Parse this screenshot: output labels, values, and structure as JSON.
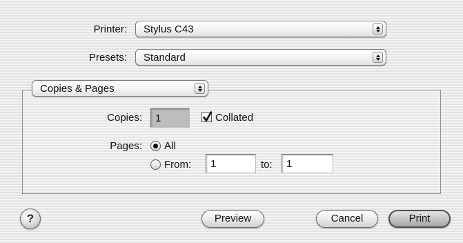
{
  "printer": {
    "label": "Printer:",
    "value": "Stylus C43"
  },
  "presets": {
    "label": "Presets:",
    "value": "Standard"
  },
  "panel": {
    "value": "Copies & Pages"
  },
  "copies": {
    "label": "Copies:",
    "value": "1",
    "collated": {
      "label": "Collated",
      "checked": true
    }
  },
  "pages": {
    "label": "Pages:",
    "all_label": "All",
    "all_selected": true,
    "from_label": "From:",
    "from_value": "1",
    "to_label": "to:",
    "to_value": "1"
  },
  "buttons": {
    "help_glyph": "?",
    "preview": "Preview",
    "cancel": "Cancel",
    "print": "Print"
  },
  "icons": {
    "popup_arrows": "up-down-arrows-icon",
    "checkmark": "checkmark-icon",
    "radio_dot": "radio-dot-icon",
    "help": "question-mark-icon"
  }
}
